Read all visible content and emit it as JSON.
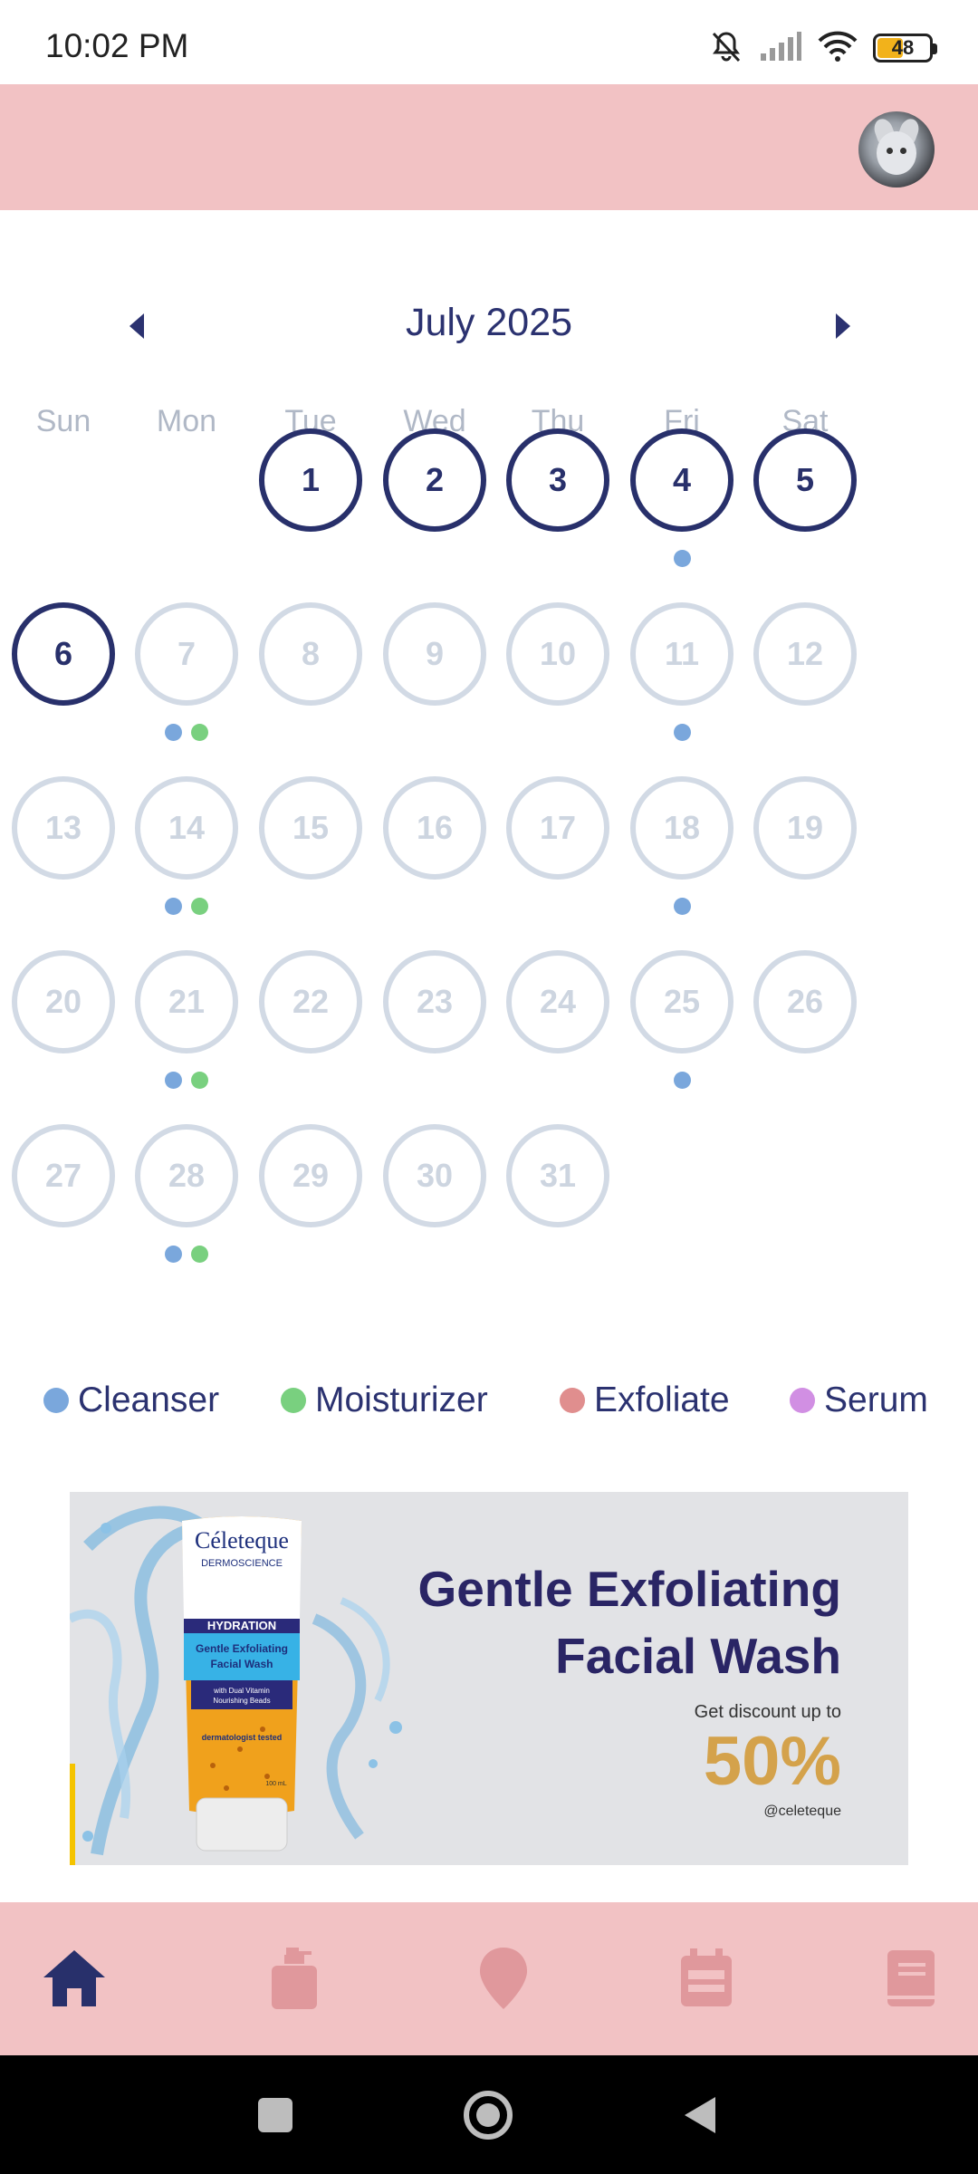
{
  "status_bar": {
    "time": "10:02 PM",
    "battery_level": "48",
    "icons": [
      "mute-bell-icon",
      "signal-icon",
      "wifi-icon",
      "battery-icon"
    ]
  },
  "header": {
    "background": "#f2c2c4",
    "avatar": "cat-avatar"
  },
  "calendar": {
    "month_title": "July 2025",
    "weekdays": [
      "Sun",
      "Mon",
      "Tue",
      "Wed",
      "Thu",
      "Fri",
      "Sat"
    ],
    "first_weekday_index": 2,
    "days_in_month": 31,
    "active_days": [
      1,
      2,
      3,
      4,
      5,
      6
    ],
    "markers": {
      "4": [
        "cleanser"
      ],
      "7": [
        "cleanser",
        "moisturizer"
      ],
      "11": [
        "cleanser"
      ],
      "14": [
        "cleanser",
        "moisturizer"
      ],
      "18": [
        "cleanser"
      ],
      "21": [
        "cleanser",
        "moisturizer"
      ],
      "25": [
        "cleanser"
      ],
      "28": [
        "cleanser",
        "moisturizer"
      ]
    }
  },
  "legend": [
    {
      "key": "cleanser",
      "label": "Cleanser",
      "color": "#7aa7dc"
    },
    {
      "key": "moisturizer",
      "label": "Moisturizer",
      "color": "#79d07f"
    },
    {
      "key": "exfoliate",
      "label": "Exfoliate",
      "color": "#e08e8e"
    },
    {
      "key": "serum",
      "label": "Serum",
      "color": "#d18fe3"
    }
  ],
  "banner": {
    "title_line1": "Gentle Exfoliating",
    "title_line2": "Facial Wash",
    "subtitle": "Get  discount up to",
    "discount": "50%",
    "handle": "@celeteque",
    "product": {
      "brand": "Céleteque",
      "line": "DERMOSCIENCE",
      "category": "HYDRATION",
      "name1": "Gentle Exfoliating",
      "name2": "Facial Wash",
      "claim1": "with Dual Vitamin",
      "claim2": "Nourishing Beads",
      "tested": "dermatologist tested",
      "size": "100 mL"
    }
  },
  "bottom_nav": [
    {
      "name": "home",
      "icon": "home-icon",
      "active": true
    },
    {
      "name": "products",
      "icon": "bottle-icon",
      "active": false
    },
    {
      "name": "location",
      "icon": "map-pin-icon",
      "active": false
    },
    {
      "name": "calendar",
      "icon": "calendar-icon",
      "active": false
    },
    {
      "name": "journal",
      "icon": "book-icon",
      "active": false
    }
  ],
  "colors": {
    "primary": "#28306b",
    "inactive_ring": "#d2dae5",
    "inactive_icon": "#e0989c",
    "accent_pink": "#f2c2c4"
  }
}
